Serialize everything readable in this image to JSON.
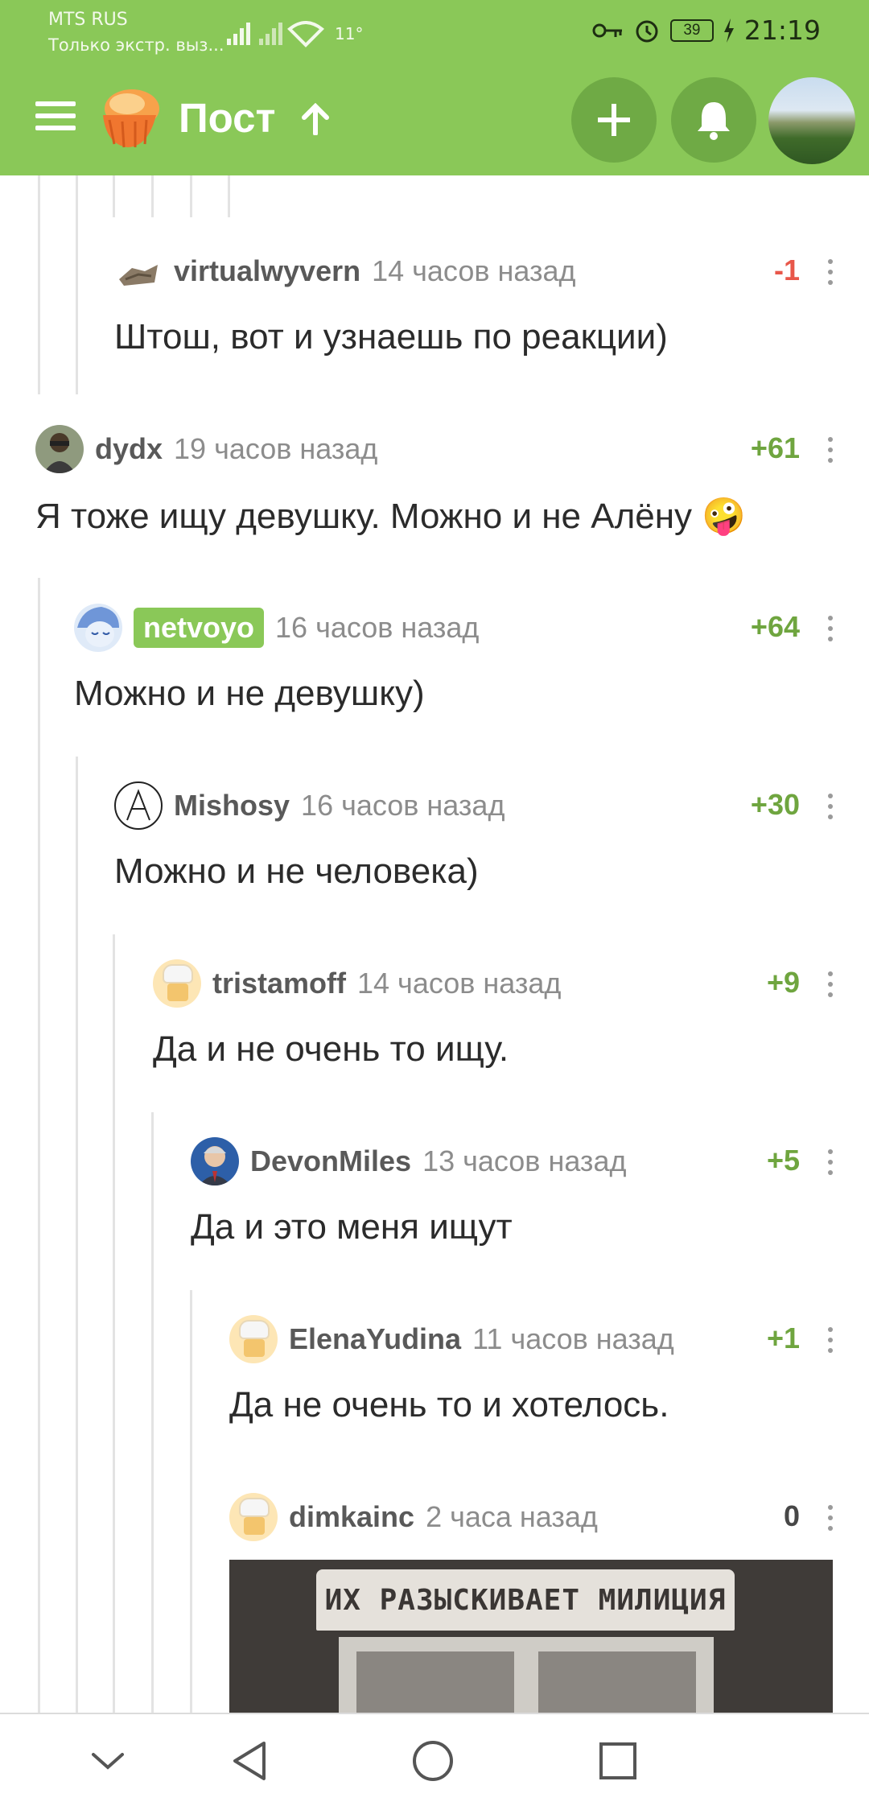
{
  "status_bar": {
    "carrier": "MTS RUS",
    "emergency": "Только экстр. выз...",
    "temperature": "11°",
    "battery": "39",
    "time": "21:19"
  },
  "app_bar": {
    "title": "Пост",
    "icons": [
      "menu-icon",
      "logo-icon",
      "up-arrow-icon",
      "plus-icon",
      "bell-icon",
      "profile-avatar"
    ],
    "accent_color": "#8ac858"
  },
  "comments": [
    {
      "author": "virtualwyvern",
      "time": "14 часов назад",
      "rating": "-1",
      "text": "Штош, вот и узнаешь по реакции)"
    },
    {
      "author": "dydx",
      "time": "19 часов назад",
      "rating": "+61",
      "text": "Я тоже ищу девушку. Можно и не Алёну 🤪"
    },
    {
      "author": "netvoyo",
      "time": "16 часов назад",
      "rating": "+64",
      "text": "Можно и не девушку)"
    },
    {
      "author": "Mishosy",
      "time": "16 часов назад",
      "rating": "+30",
      "text": "Можно и не человека)"
    },
    {
      "author": "tristamoff",
      "time": "14 часов назад",
      "rating": "+9",
      "text": "Да и не очень то ищу."
    },
    {
      "author": "DevonMiles",
      "time": "13 часов назад",
      "rating": "+5",
      "text": "Да и это меня ищут"
    },
    {
      "author": "ElenaYudina",
      "time": "11 часов назад",
      "rating": "+1",
      "text": "Да не очень то и хотелось."
    },
    {
      "author": "dimkainc",
      "time": "2 часа назад",
      "rating": "0",
      "text": ""
    }
  ],
  "attachment": {
    "sign_text": "ИХ РАЗЫСКИВАЕТ МИЛИЦИЯ"
  },
  "nav_bar": {
    "icons": [
      "chevron-down-icon",
      "back-icon",
      "home-icon",
      "recents-icon"
    ]
  }
}
